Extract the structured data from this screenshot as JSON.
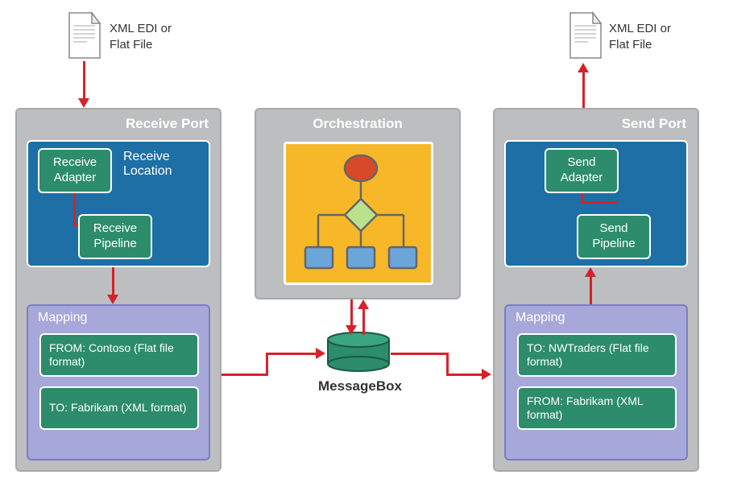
{
  "receivePort": {
    "title": "Receive Port",
    "location": {
      "label": "Receive Location",
      "adapter": "Receive Adapter",
      "pipeline": "Receive Pipeline"
    },
    "mapping": {
      "title": "Mapping",
      "from": "FROM: Contoso (Flat file format)",
      "to": "TO: Fabrikam (XML format)"
    }
  },
  "orchestration": {
    "title": "Orchestration"
  },
  "sendPort": {
    "title": "Send Port",
    "adapter": "Send Adapter",
    "pipeline": "Send Pipeline",
    "mapping": {
      "title": "Mapping",
      "to": "TO: NWTraders (Flat file format)",
      "from": "FROM: Fabrikam (XML format)"
    }
  },
  "messageBox": {
    "label": "MessageBox"
  },
  "input": {
    "label": "XML EDI or Flat File"
  },
  "output": {
    "label": "XML EDI or Flat File"
  },
  "colors": {
    "panelGray": "#bdbebf",
    "portBlue": "#1d6fa5",
    "boxGreen": "#2c8c6c",
    "mappingPurple": "#a5a8d8",
    "orchYellow": "#f6b829",
    "arrowRed": "#d6222a"
  }
}
